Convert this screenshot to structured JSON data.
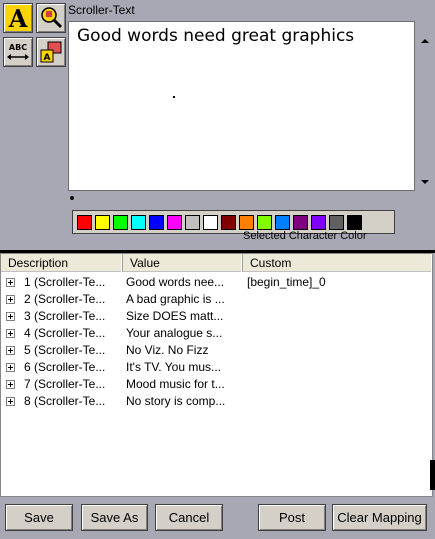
{
  "editor": {
    "title": "Scroller-Text",
    "content": "Good words need great graphics"
  },
  "tools": [
    {
      "name": "text-style-icon"
    },
    {
      "name": "zoom-text-icon"
    },
    {
      "name": "text-width-icon"
    },
    {
      "name": "text-color-image-icon"
    }
  ],
  "palette": {
    "label": "Selected Character Color",
    "colors": [
      "#ff0000",
      "#ffff00",
      "#00ff00",
      "#00ffff",
      "#0000ff",
      "#ff00ff",
      "#c0c0c0",
      "#ffffff",
      "#800000",
      "#ff8000",
      "#80ff00",
      "#0080ff",
      "#800080",
      "#8000ff",
      "#606060",
      "#000000"
    ]
  },
  "table": {
    "headers": {
      "description": "Description",
      "value": "Value",
      "custom": "Custom"
    },
    "rows": [
      {
        "description": "1 (Scroller-Te...",
        "value": "Good words nee...",
        "custom": "[begin_time]_0"
      },
      {
        "description": "2 (Scroller-Te...",
        "value": "A bad graphic is ...",
        "custom": ""
      },
      {
        "description": "3 (Scroller-Te...",
        "value": "Size DOES matt...",
        "custom": ""
      },
      {
        "description": "4 (Scroller-Te...",
        "value": "Your analogue s...",
        "custom": ""
      },
      {
        "description": "5 (Scroller-Te...",
        "value": "No Viz. No Fizz",
        "custom": ""
      },
      {
        "description": "6 (Scroller-Te...",
        "value": "It's TV. You mus...",
        "custom": ""
      },
      {
        "description": "7 (Scroller-Te...",
        "value": "Mood music for t...",
        "custom": ""
      },
      {
        "description": "8 (Scroller-Te...",
        "value": "No story is comp...",
        "custom": ""
      }
    ]
  },
  "buttons": {
    "save": "Save",
    "save_as": "Save As",
    "cancel": "Cancel",
    "post": "Post",
    "clear_mapping": "Clear Mapping"
  }
}
